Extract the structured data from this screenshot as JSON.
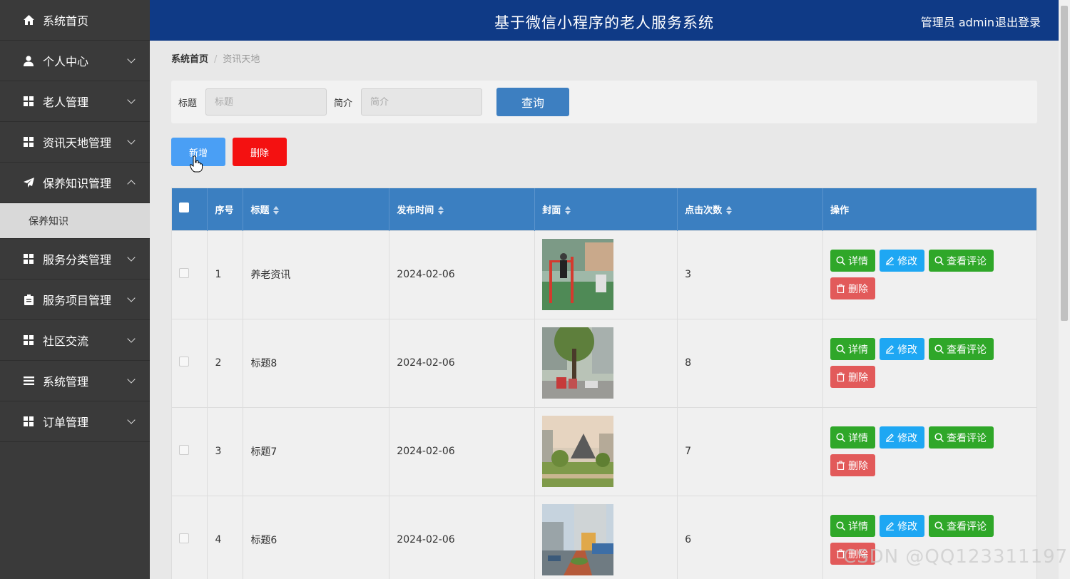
{
  "header": {
    "title": "基于微信小程序的老人服务系统",
    "user": "管理员 admin",
    "logout": "退出登录"
  },
  "sidebar": {
    "items": [
      {
        "label": "系统首页",
        "icon": "home-icon"
      },
      {
        "label": "个人中心",
        "icon": "user-icon"
      },
      {
        "label": "老人管理",
        "icon": "grid-icon"
      },
      {
        "label": "资讯天地管理",
        "icon": "grid-icon"
      },
      {
        "label": "保养知识管理",
        "icon": "send-icon",
        "expanded": true
      },
      {
        "label": "服务分类管理",
        "icon": "grid-icon"
      },
      {
        "label": "服务项目管理",
        "icon": "clipboard-icon"
      },
      {
        "label": "社区交流",
        "icon": "grid-icon"
      },
      {
        "label": "系统管理",
        "icon": "menu-icon"
      },
      {
        "label": "订单管理",
        "icon": "grid-icon"
      }
    ],
    "sub_item": "保养知识"
  },
  "breadcrumb": {
    "home": "系统首页",
    "current": "资讯天地"
  },
  "search": {
    "title_label": "标题",
    "title_placeholder": "标题",
    "intro_label": "简介",
    "intro_placeholder": "简介",
    "query_button": "查询"
  },
  "actions": {
    "add": "新增",
    "delete": "删除"
  },
  "table": {
    "headers": {
      "index": "序号",
      "title": "标题",
      "publish_time": "发布时间",
      "cover": "封面",
      "clicks": "点击次数",
      "ops": "操作"
    },
    "op_labels": {
      "detail": "详情",
      "edit": "修改",
      "comments": "查看评论",
      "remove": "删除"
    },
    "rows": [
      {
        "index": "1",
        "title": "养老资讯",
        "publish_time": "2024-02-06",
        "clicks": "3"
      },
      {
        "index": "2",
        "title": "标题8",
        "publish_time": "2024-02-06",
        "clicks": "8"
      },
      {
        "index": "3",
        "title": "标题7",
        "publish_time": "2024-02-06",
        "clicks": "7"
      },
      {
        "index": "4",
        "title": "标题6",
        "publish_time": "2024-02-06",
        "clicks": "6"
      }
    ]
  },
  "watermark": "CSDN @QQ123311197"
}
